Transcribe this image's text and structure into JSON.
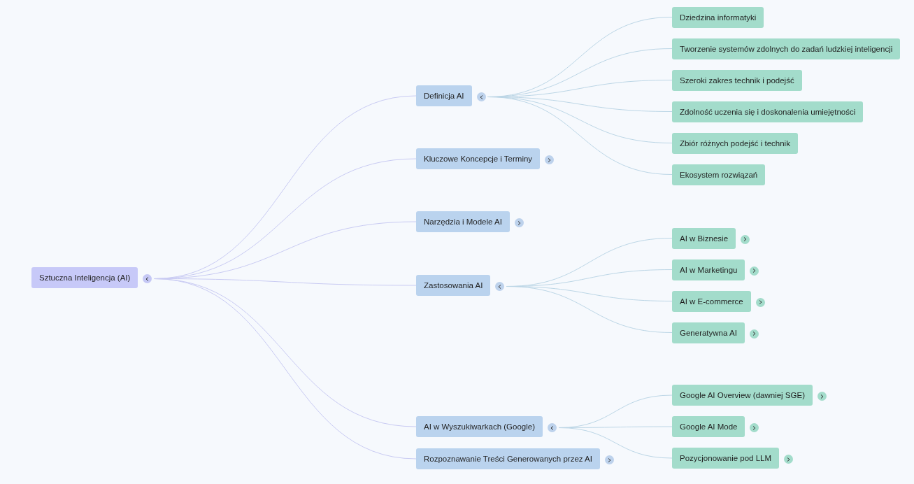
{
  "root": {
    "label": "Sztuczna Inteligencja (AI)",
    "expanded": true,
    "children": [
      {
        "label": "Definicja AI",
        "expanded": true,
        "children": [
          {
            "label": "Dziedzina informatyki"
          },
          {
            "label": "Tworzenie systemów zdolnych do zadań ludzkiej inteligencji"
          },
          {
            "label": "Szeroki zakres technik i podejść"
          },
          {
            "label": "Zdolność uczenia się i doskonalenia umiejętności"
          },
          {
            "label": "Zbiór różnych podejść i technik"
          },
          {
            "label": "Ekosystem rozwiązań"
          }
        ]
      },
      {
        "label": "Kluczowe Koncepcje i Terminy",
        "expanded": false
      },
      {
        "label": "Narzędzia i Modele AI",
        "expanded": false
      },
      {
        "label": "Zastosowania AI",
        "expanded": true,
        "children": [
          {
            "label": "AI w Biznesie",
            "expanded": false
          },
          {
            "label": "AI w Marketingu",
            "expanded": false
          },
          {
            "label": "AI w E-commerce",
            "expanded": false
          },
          {
            "label": "Generatywna AI",
            "expanded": false
          }
        ]
      },
      {
        "label": "AI w Wyszukiwarkach (Google)",
        "expanded": true,
        "children": [
          {
            "label": "Google AI Overview (dawniej SGE)",
            "expanded": false
          },
          {
            "label": "Google AI Mode",
            "expanded": false
          },
          {
            "label": "Pozycjonowanie pod LLM",
            "expanded": false
          }
        ]
      },
      {
        "label": "Rozpoznawanie Treści Generowanych przez AI",
        "expanded": false
      }
    ]
  }
}
